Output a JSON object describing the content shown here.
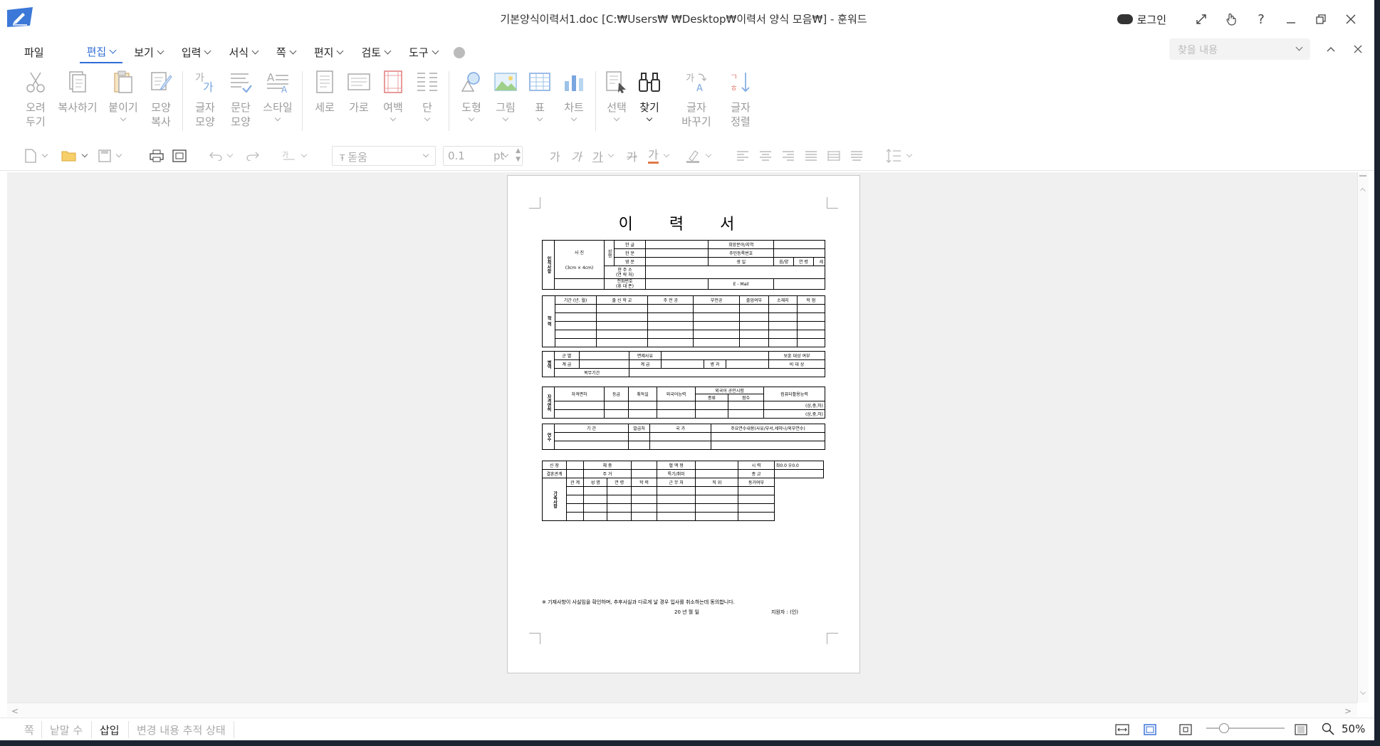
{
  "window": {
    "title": "기본양식이력서1.doc [C:₩Users₩        ₩Desktop₩이력서 양식 모음₩] - 훈워드",
    "login": "로그인"
  },
  "menu": [
    {
      "label": "파일",
      "chev": false,
      "active": false
    },
    {
      "label": "편집",
      "chev": true,
      "active": true
    },
    {
      "label": "보기",
      "chev": true,
      "active": false
    },
    {
      "label": "입력",
      "chev": true,
      "active": false
    },
    {
      "label": "서식",
      "chev": true,
      "active": false
    },
    {
      "label": "쪽",
      "chev": true,
      "active": false
    },
    {
      "label": "편지",
      "chev": true,
      "active": false
    },
    {
      "label": "검토",
      "chev": true,
      "active": false
    },
    {
      "label": "도구",
      "chev": true,
      "active": false
    }
  ],
  "search": {
    "placeholder": "찾을 내용"
  },
  "ribbon": {
    "cut": [
      "오려",
      "두기"
    ],
    "copy": "복사하기",
    "paste": "붙이기",
    "format_copy": [
      "모양",
      "복사"
    ],
    "char_shape": [
      "글자",
      "모양"
    ],
    "para_shape": [
      "문단",
      "모양"
    ],
    "style": "스타일",
    "portrait": "세로",
    "landscape": "가로",
    "margin": "여백",
    "column": "단",
    "shape": "도형",
    "picture": "그림",
    "table": "표",
    "chart": "차트",
    "select": "선택",
    "find": "찾기",
    "replace": [
      "글자",
      "바꾸기"
    ],
    "sort": [
      "글자",
      "정렬"
    ]
  },
  "toolbar": {
    "font": "돋움",
    "size": "0.1",
    "unit": "pt"
  },
  "document": {
    "title": "이 력 서",
    "personal": {
      "side": "인적사항",
      "photo": "사 진",
      "photo_size": "(3cm × 4cm)",
      "name_side": "성명",
      "name_ko": "한 글",
      "name_hanja": "한 문",
      "name_en": "영 문",
      "hope": "희망분야/지역",
      "rrn": "주민등록번호",
      "birth": "생 일",
      "lunar": "음/양",
      "age": "연 령",
      "age_unit": "세",
      "address": [
        "현 주 소",
        "(연 락 처)"
      ],
      "phone": [
        "전화번호",
        "(휴 대 폰)"
      ],
      "email": "E - Mail"
    },
    "education": {
      "side": "학 력",
      "headers": [
        "기간 (년. 월)",
        "출 신 학 교",
        "주 전 공",
        "부전공",
        "졸업여부",
        "소재지",
        "학 점"
      ]
    },
    "military": {
      "side": "병역",
      "r1": [
        "군 별",
        "면제사유",
        "보훈 대상 여부"
      ],
      "r2": [
        "계 급",
        "계 급",
        "병 과",
        "비 대 상"
      ],
      "r3": [
        "복무기간"
      ]
    },
    "license": {
      "side": "자격면허",
      "headers": [
        "자격면허",
        "등급",
        "취득일",
        "외국어능력",
        "외국어 공인시험",
        "종류",
        "점수",
        "컴퓨터활용능력"
      ],
      "grades": [
        "(상,중,하)",
        "(상,중,하)"
      ]
    },
    "training": {
      "side": "연수",
      "headers": [
        "기 간",
        "발급처",
        "국 가",
        "주요연수내용(사유/부서,세미나/외부연수)"
      ]
    },
    "family": {
      "r1": [
        "신 장",
        "체 중",
        "혈 액 형",
        "시 력",
        "좌0.0 우0.0"
      ],
      "r2": [
        "결혼관계",
        "주 거",
        "특기/취미",
        "종 교"
      ],
      "side": "가족사항",
      "headers": [
        "관 계",
        "성 명",
        "연 령",
        "학 력",
        "근 무 처",
        "직 위",
        "동거여부"
      ]
    },
    "pledge": "※ 기재사항이 사실임을 확인하며, 추후사실과 다르게 날 경우 입사를 취소하는데 동의합니다.",
    "date": "20     년     월     일",
    "applicant": "지원자 :                (인)"
  },
  "status": {
    "page": "쪽",
    "words": "낱말 수",
    "insert": "삽입",
    "track": "변경 내용 추적 상태",
    "zoom": "50%"
  }
}
